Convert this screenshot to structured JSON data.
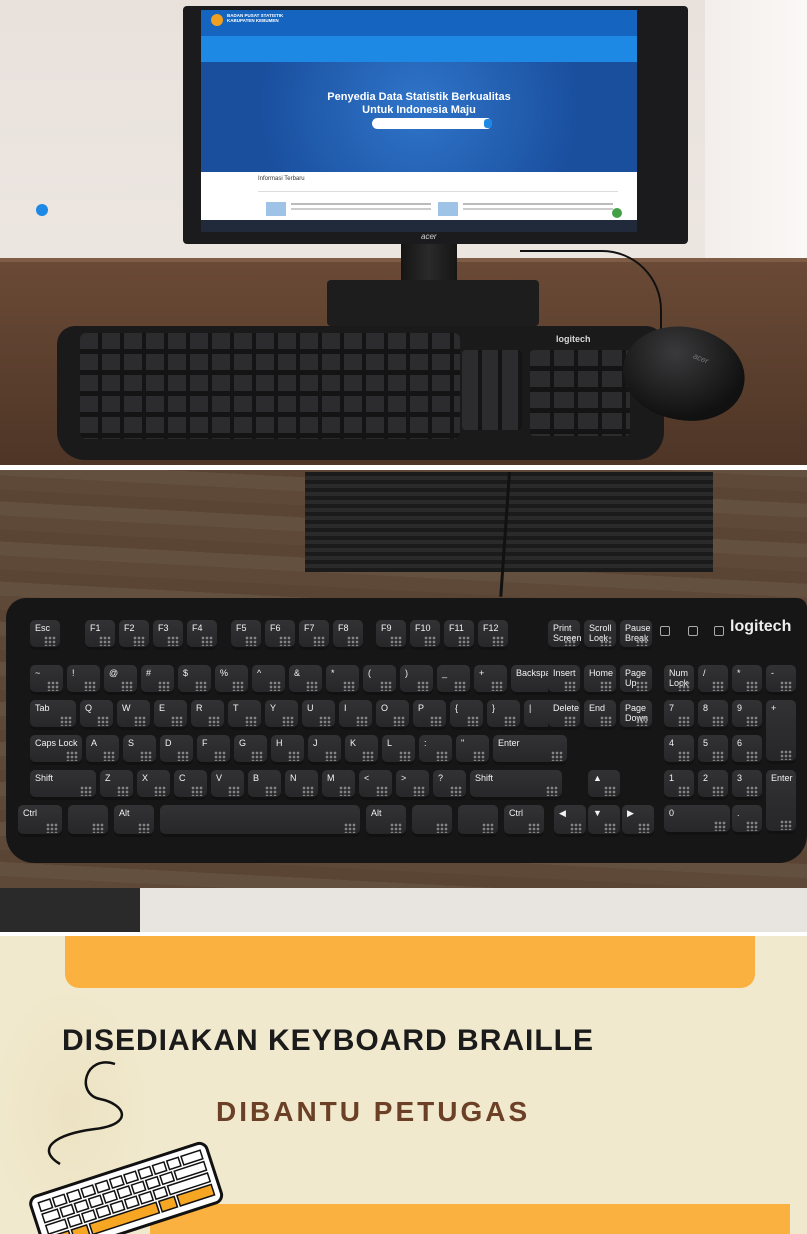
{
  "photo1": {
    "site_brand": "BADAN PUSAT STATISTIK KABUPATEN KEBUMEN",
    "hero_title_line1": "Penyedia Data Statistik Berkualitas",
    "hero_title_line2": "Untuk Indonesia Maju",
    "section_title": "Informasi Terbaru",
    "monitor_brand": "acer",
    "keyboard_brand": "logitech"
  },
  "photo2": {
    "keyboard_brand": "logitech",
    "rows": [
      [
        "Esc",
        "F1",
        "F2",
        "F3",
        "F4",
        "F5",
        "F6",
        "F7",
        "F8",
        "F9",
        "F10",
        "F11",
        "F12"
      ],
      [
        "~",
        "!",
        "@",
        "#",
        "$",
        "%",
        "^",
        "&",
        "*",
        "(",
        ")",
        "_",
        "+",
        "Backspace"
      ],
      [
        "Tab",
        "Q",
        "W",
        "E",
        "R",
        "T",
        "Y",
        "U",
        "I",
        "O",
        "P",
        "{",
        "}",
        "|"
      ],
      [
        "Caps Lock",
        "A",
        "S",
        "D",
        "F",
        "G",
        "H",
        "J",
        "K",
        "L",
        ":",
        "\"",
        "Enter"
      ],
      [
        "Shift",
        "Z",
        "X",
        "C",
        "V",
        "B",
        "N",
        "M",
        "<",
        ">",
        "?",
        "Shift"
      ],
      [
        "Ctrl",
        "",
        "Alt",
        "",
        "Alt",
        "",
        "",
        "Ctrl"
      ]
    ],
    "nav_keys": [
      "Print Screen",
      "Scroll Lock",
      "Pause Break",
      "Insert",
      "Home",
      "Page Up",
      "Delete",
      "End",
      "Page Down"
    ],
    "numpad_keys": [
      "Num Lock",
      "/",
      "*",
      "-",
      "7",
      "8",
      "9",
      "+",
      "4",
      "5",
      "6",
      "1",
      "2",
      "3",
      "Enter",
      "0",
      "."
    ]
  },
  "banner": {
    "headline": "DISEDIAKAN KEYBOARD BRAILLE",
    "subheadline": "DIBANTU PETUGAS",
    "accent_color": "#fbb140",
    "background_color": "#f1e9cd"
  }
}
